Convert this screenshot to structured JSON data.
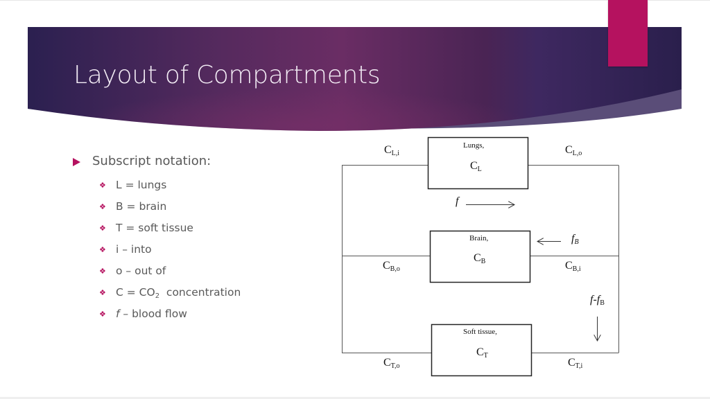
{
  "slide": {
    "title": "Layout of Compartments",
    "colors": {
      "accent": "#b5125f",
      "header_dark": "#2a1f4d",
      "header_mid": "#6b2a62",
      "body_text": "#595959"
    }
  },
  "bullets": {
    "main": "Subscript notation:",
    "main_icon": "triangle-bullet-icon",
    "sub_icon": "diamond-bullet-icon",
    "items": [
      {
        "text": "L = lungs"
      },
      {
        "text": "B = brain"
      },
      {
        "text": "T = soft tissue"
      },
      {
        "text": "i – into"
      },
      {
        "text": "o – out of"
      },
      {
        "pre": "C = CO",
        "sub": "2",
        "post": "  concentration"
      },
      {
        "ital": "f",
        "post": " – blood flow"
      }
    ]
  },
  "diagram": {
    "compartments": [
      {
        "id": "lungs",
        "title": "Lungs,",
        "symbol": "C",
        "symbol_sub": "L"
      },
      {
        "id": "brain",
        "title": "Brain,",
        "symbol": "C",
        "symbol_sub": "B"
      },
      {
        "id": "soft_tissue",
        "title": "Soft tissue,",
        "symbol": "C",
        "symbol_sub": "T"
      }
    ],
    "labels": {
      "cli": {
        "main": "C",
        "sub": "L,i"
      },
      "clo": {
        "main": "C",
        "sub": "L,o"
      },
      "cbo": {
        "main": "C",
        "sub": "B,o"
      },
      "cbi": {
        "main": "C",
        "sub": "B,i"
      },
      "cto": {
        "main": "C",
        "sub": "T,o"
      },
      "cti": {
        "main": "C",
        "sub": "T,i"
      }
    },
    "flows": {
      "total": {
        "label": "f",
        "direction": "right"
      },
      "brain": {
        "label": "f",
        "sub": "B",
        "direction": "left"
      },
      "tissue": {
        "label": "f-f",
        "sub": "B",
        "direction": "down"
      }
    }
  }
}
